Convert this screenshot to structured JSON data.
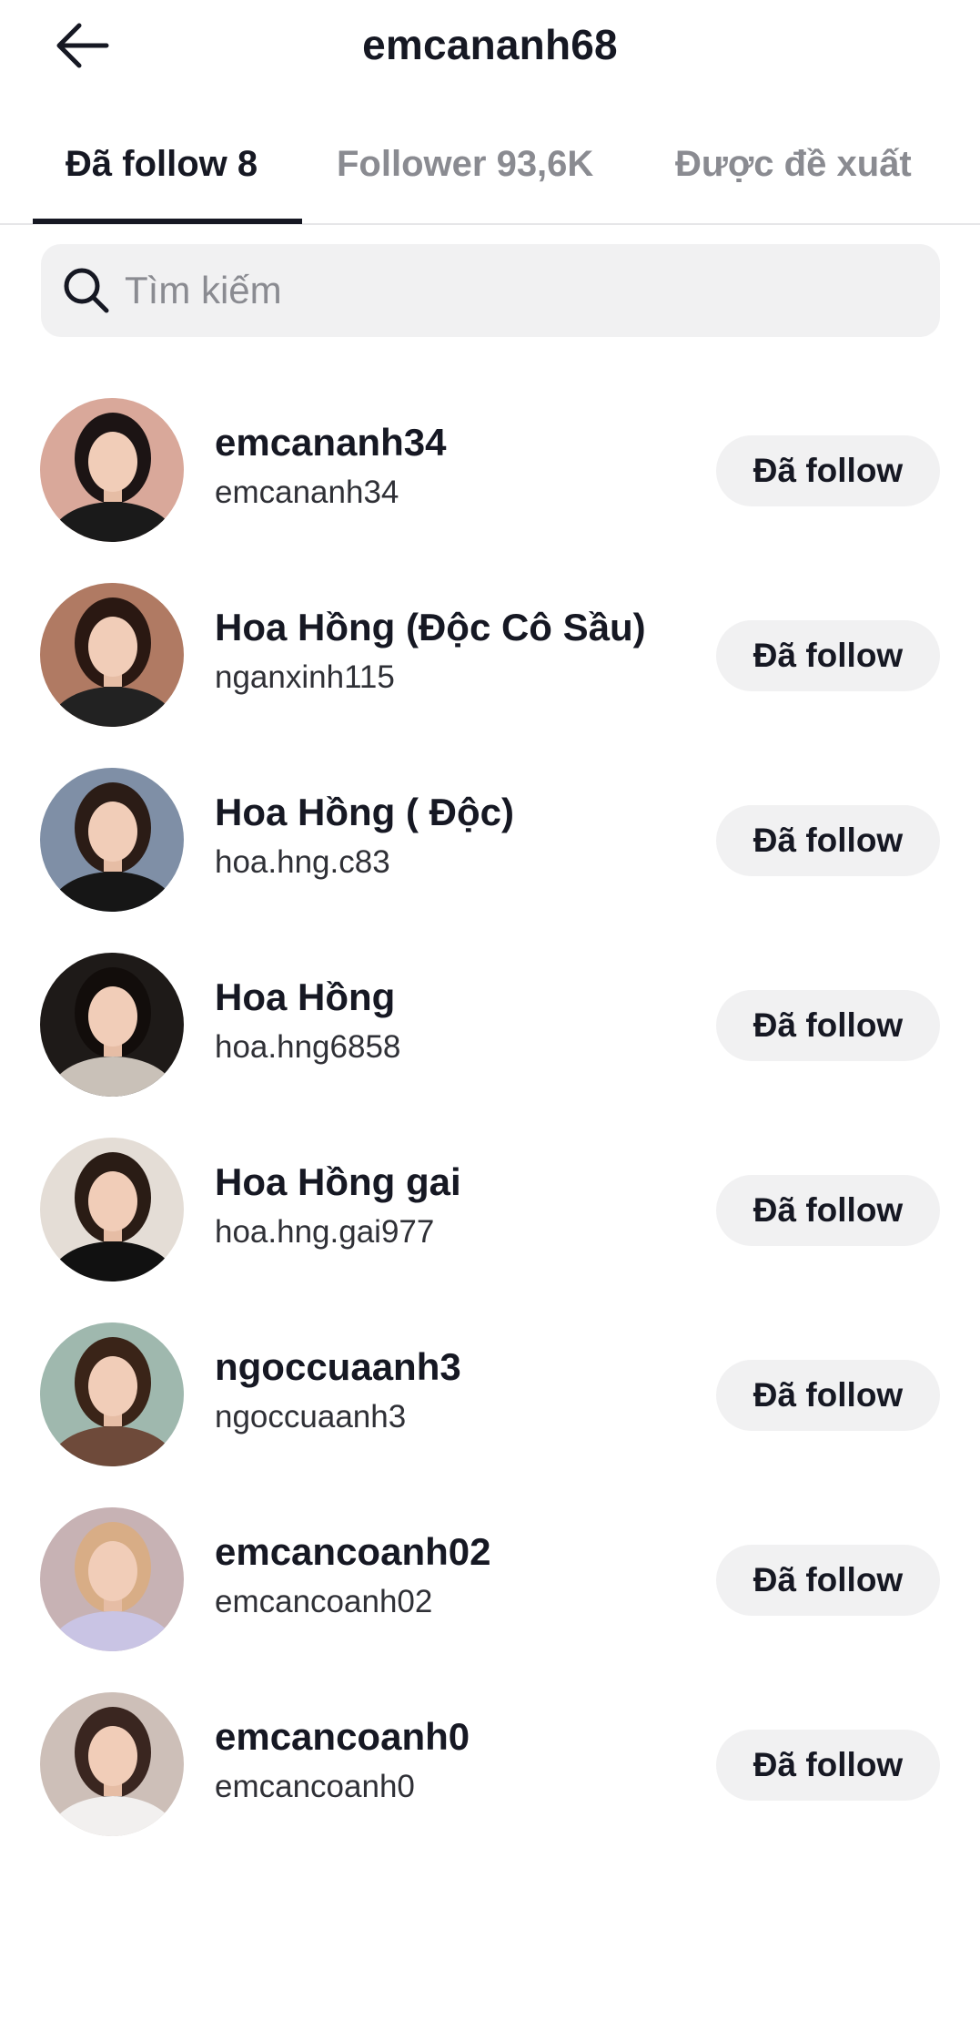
{
  "header": {
    "title": "emcananh68",
    "back_icon": "arrow-left-icon"
  },
  "tabs": [
    {
      "label": "Đã follow 8",
      "active": true
    },
    {
      "label": "Follower 93,6K",
      "active": false
    },
    {
      "label": "Được đề xuất",
      "active": false
    }
  ],
  "search": {
    "placeholder": "Tìm kiếm",
    "value": "",
    "icon": "search-icon"
  },
  "following": [
    {
      "display_name": "emcananh34",
      "username": "emcananh34",
      "button_label": "Đã follow",
      "avatar_bg": "#d9a89a",
      "avatar_hair": "#1c1414",
      "avatar_shirt": "#1a1a1a"
    },
    {
      "display_name": "Hoa Hồng (Độc Cô Sầu)",
      "username": "nganxinh115",
      "button_label": "Đã follow",
      "avatar_bg": "#b07a63",
      "avatar_hair": "#2a1812",
      "avatar_shirt": "#222222"
    },
    {
      "display_name": "Hoa Hồng ( Độc)",
      "username": "hoa.hng.c83",
      "button_label": "Đã follow",
      "avatar_bg": "#7f8fa6",
      "avatar_hair": "#2b1c16",
      "avatar_shirt": "#161616"
    },
    {
      "display_name": "Hoa Hồng",
      "username": "hoa.hng6858",
      "button_label": "Đã follow",
      "avatar_bg": "#1e1a18",
      "avatar_hair": "#120d0b",
      "avatar_shirt": "#c9c1b8"
    },
    {
      "display_name": "Hoa Hồng gai",
      "username": "hoa.hng.gai977",
      "button_label": "Đã follow",
      "avatar_bg": "#e4ddd6",
      "avatar_hair": "#2a1c15",
      "avatar_shirt": "#111111"
    },
    {
      "display_name": "ngoccuaanh3",
      "username": "ngoccuaanh3",
      "button_label": "Đã follow",
      "avatar_bg": "#9fb8ae",
      "avatar_hair": "#3a2418",
      "avatar_shirt": "#6e4a3a"
    },
    {
      "display_name": "emcancoanh02",
      "username": "emcancoanh02",
      "button_label": "Đã follow",
      "avatar_bg": "#c7b2b4",
      "avatar_hair": "#d8ad86",
      "avatar_shirt": "#c9c4e4"
    },
    {
      "display_name": "emcancoanh0",
      "username": "emcancoanh0",
      "button_label": "Đã follow",
      "avatar_bg": "#cdbfb8",
      "avatar_hair": "#3a2620",
      "avatar_shirt": "#f2f0ef"
    }
  ]
}
